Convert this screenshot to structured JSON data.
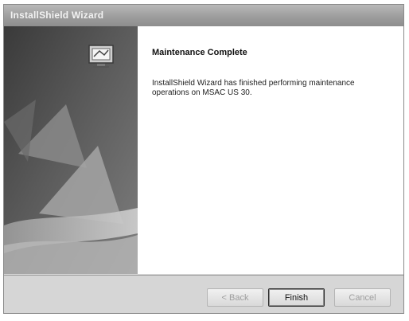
{
  "window": {
    "title": "InstallShield Wizard"
  },
  "page": {
    "heading": "Maintenance Complete",
    "message": "InstallShield Wizard has finished performing maintenance operations on MSAC US 30."
  },
  "buttons": {
    "back": "< Back",
    "finish": "Finish",
    "cancel": "Cancel"
  },
  "icons": {
    "wizard": "installer-computer-icon"
  }
}
